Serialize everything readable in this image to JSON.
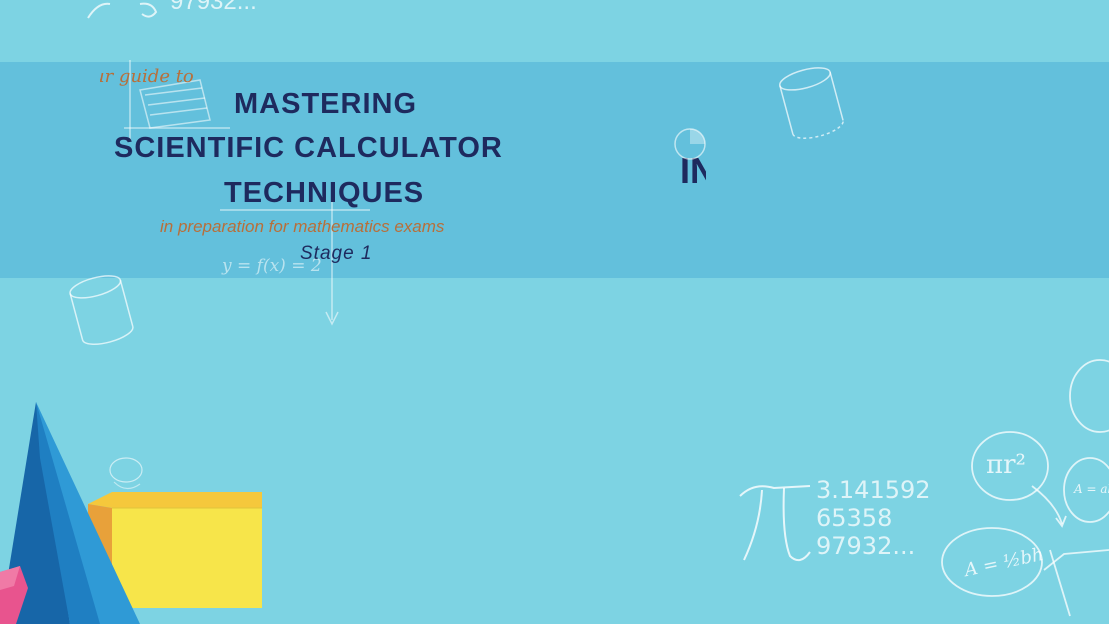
{
  "header": {
    "tagline": "your guide to",
    "title_line1": "MASTERING",
    "title_line2": "SCIENTIFIC CALCULATOR",
    "title_line3": "TECHNIQUES",
    "subtitle": "in preparation for mathematics exams",
    "stage": "Stage 1"
  },
  "right_panel": {
    "text": "IN"
  },
  "doodles": {
    "pi_digits": "3.141592\n65358\n97932...",
    "top_digits": "97932...",
    "function_label": "y = f(x) = 2",
    "pi_r_squared": "πr²",
    "triangle_area": "A = ½bh",
    "rect_area": "A = ab"
  },
  "colors": {
    "background": "#7dd3e3",
    "band": "#63c0dc",
    "title": "#1e2a5e",
    "accent_text": "#b86f3a",
    "cone_dark": "#1766a8",
    "cone_light": "#2f9ad6",
    "box_front": "#f7e54a",
    "box_top": "#f5c83c",
    "box_side": "#e8a13a"
  }
}
